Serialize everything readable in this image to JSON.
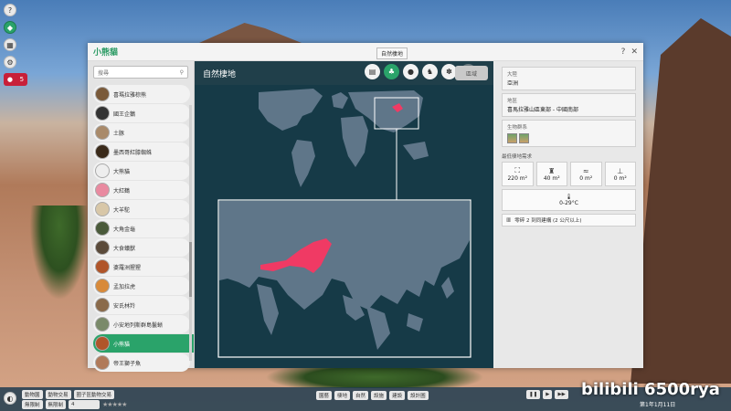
{
  "hud": {
    "help": "?",
    "user_count": "5"
  },
  "window": {
    "title": "小熊貓",
    "tab_tooltip": "自然棲地",
    "help_icon": "?",
    "close_icon": "✕"
  },
  "list": {
    "search_placeholder": "搜尋",
    "items": [
      {
        "label": "喜瑪拉雅棕熊",
        "color": "#7a5a3a"
      },
      {
        "label": "國王企鵝",
        "color": "#333333"
      },
      {
        "label": "土豚",
        "color": "#a98a6a"
      },
      {
        "label": "墨西哥紅膝蜘蛛",
        "color": "#3a2a1a"
      },
      {
        "label": "大熊貓",
        "color": "#eeeeee"
      },
      {
        "label": "大紅鶴",
        "color": "#e98aa0"
      },
      {
        "label": "大羊駝",
        "color": "#d8c7a8"
      },
      {
        "label": "大角金龜",
        "color": "#4a5a3a"
      },
      {
        "label": "大食蟻獸",
        "color": "#5a4a3a"
      },
      {
        "label": "婆羅洲猩猩",
        "color": "#b0552a"
      },
      {
        "label": "孟加拉虎",
        "color": "#d88a3a"
      },
      {
        "label": "安氏林羚",
        "color": "#8a6a4a"
      },
      {
        "label": "小安地列斯群島鬣蜥",
        "color": "#7a8a6a"
      },
      {
        "label": "小熊貓",
        "color": "#b0552a",
        "selected": true
      },
      {
        "label": "帝王獅子魚",
        "color": "#b07a5a"
      }
    ]
  },
  "map": {
    "header_title": "自然棲地",
    "zone_button": "區域",
    "category_icons": [
      "book-icon",
      "habitat-icon",
      "food-icon",
      "behavior-icon",
      "paw-icon",
      "trophy-icon"
    ]
  },
  "info": {
    "continent_label": "大陸",
    "continent_value": "亞洲",
    "region_label": "地區",
    "region_value": "喜馬拉雅山區東部 - 中國南部",
    "biome_label": "生物群系",
    "req_title": "最低棲地需求",
    "requirements": [
      {
        "icon": "land-icon",
        "value": "220 m²"
      },
      {
        "icon": "climbing-icon",
        "value": "40 m²"
      },
      {
        "icon": "water-icon",
        "value": "0 m²"
      },
      {
        "icon": "deep-water-icon",
        "value": "0 m²"
      }
    ],
    "temperature": "0-29°C",
    "group": "零碎 2 到同建構 (2 公尺以上)"
  },
  "bottom": {
    "row1": [
      "動物園",
      "動物交易",
      "圈子區動物交易"
    ],
    "mode1": "無限制",
    "mode2": "無限制",
    "money": "4",
    "stars": "★★★★★",
    "mid": [
      "園藝",
      "棲地",
      "自然",
      "設施",
      "建設",
      "設計圖"
    ],
    "date": "第1年1月11日"
  },
  "watermark": "bilibili 6500rya"
}
